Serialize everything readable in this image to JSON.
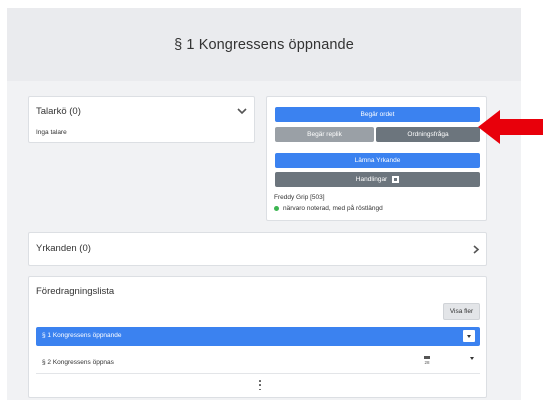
{
  "header": {
    "title": "§ 1 Kongressens öppnande"
  },
  "speakers": {
    "title": "Talarkö (0)",
    "empty_text": "Inga talare"
  },
  "actions": {
    "request_floor": "Begär ordet",
    "request_reply": "Begär replik",
    "point_of_order": "Ordningsfråga",
    "submit_proposal": "Lämna Yrkande",
    "documents": "Handlingar",
    "user": "Freddy Grip  [503]",
    "presence": "närvaro noterad, med på röstlängd"
  },
  "proposals": {
    "title": "Yrkanden (0)"
  },
  "agenda": {
    "title": "Föredragningslista",
    "show_more": "Visa fler",
    "items": [
      {
        "label": "§ 1 Kongressens öppnande"
      },
      {
        "label": "§ 2 Kongressens öppnas",
        "date": "28"
      }
    ]
  },
  "colors": {
    "primary": "#3b82f0",
    "secondary_light": "#9aa0a6",
    "secondary_dark": "#6c757d",
    "presence_dot": "#3cb551",
    "arrow": "#e8000b"
  },
  "icons": {
    "speakers_toggle": "chevron-down-icon",
    "proposals_toggle": "chevron-right-icon",
    "documents": "document-icon",
    "agenda_item_menu": "caret-down-icon",
    "agenda_item_date": "calendar-icon",
    "agenda_more": "kebab-icon",
    "callout": "arrow-left-icon"
  }
}
